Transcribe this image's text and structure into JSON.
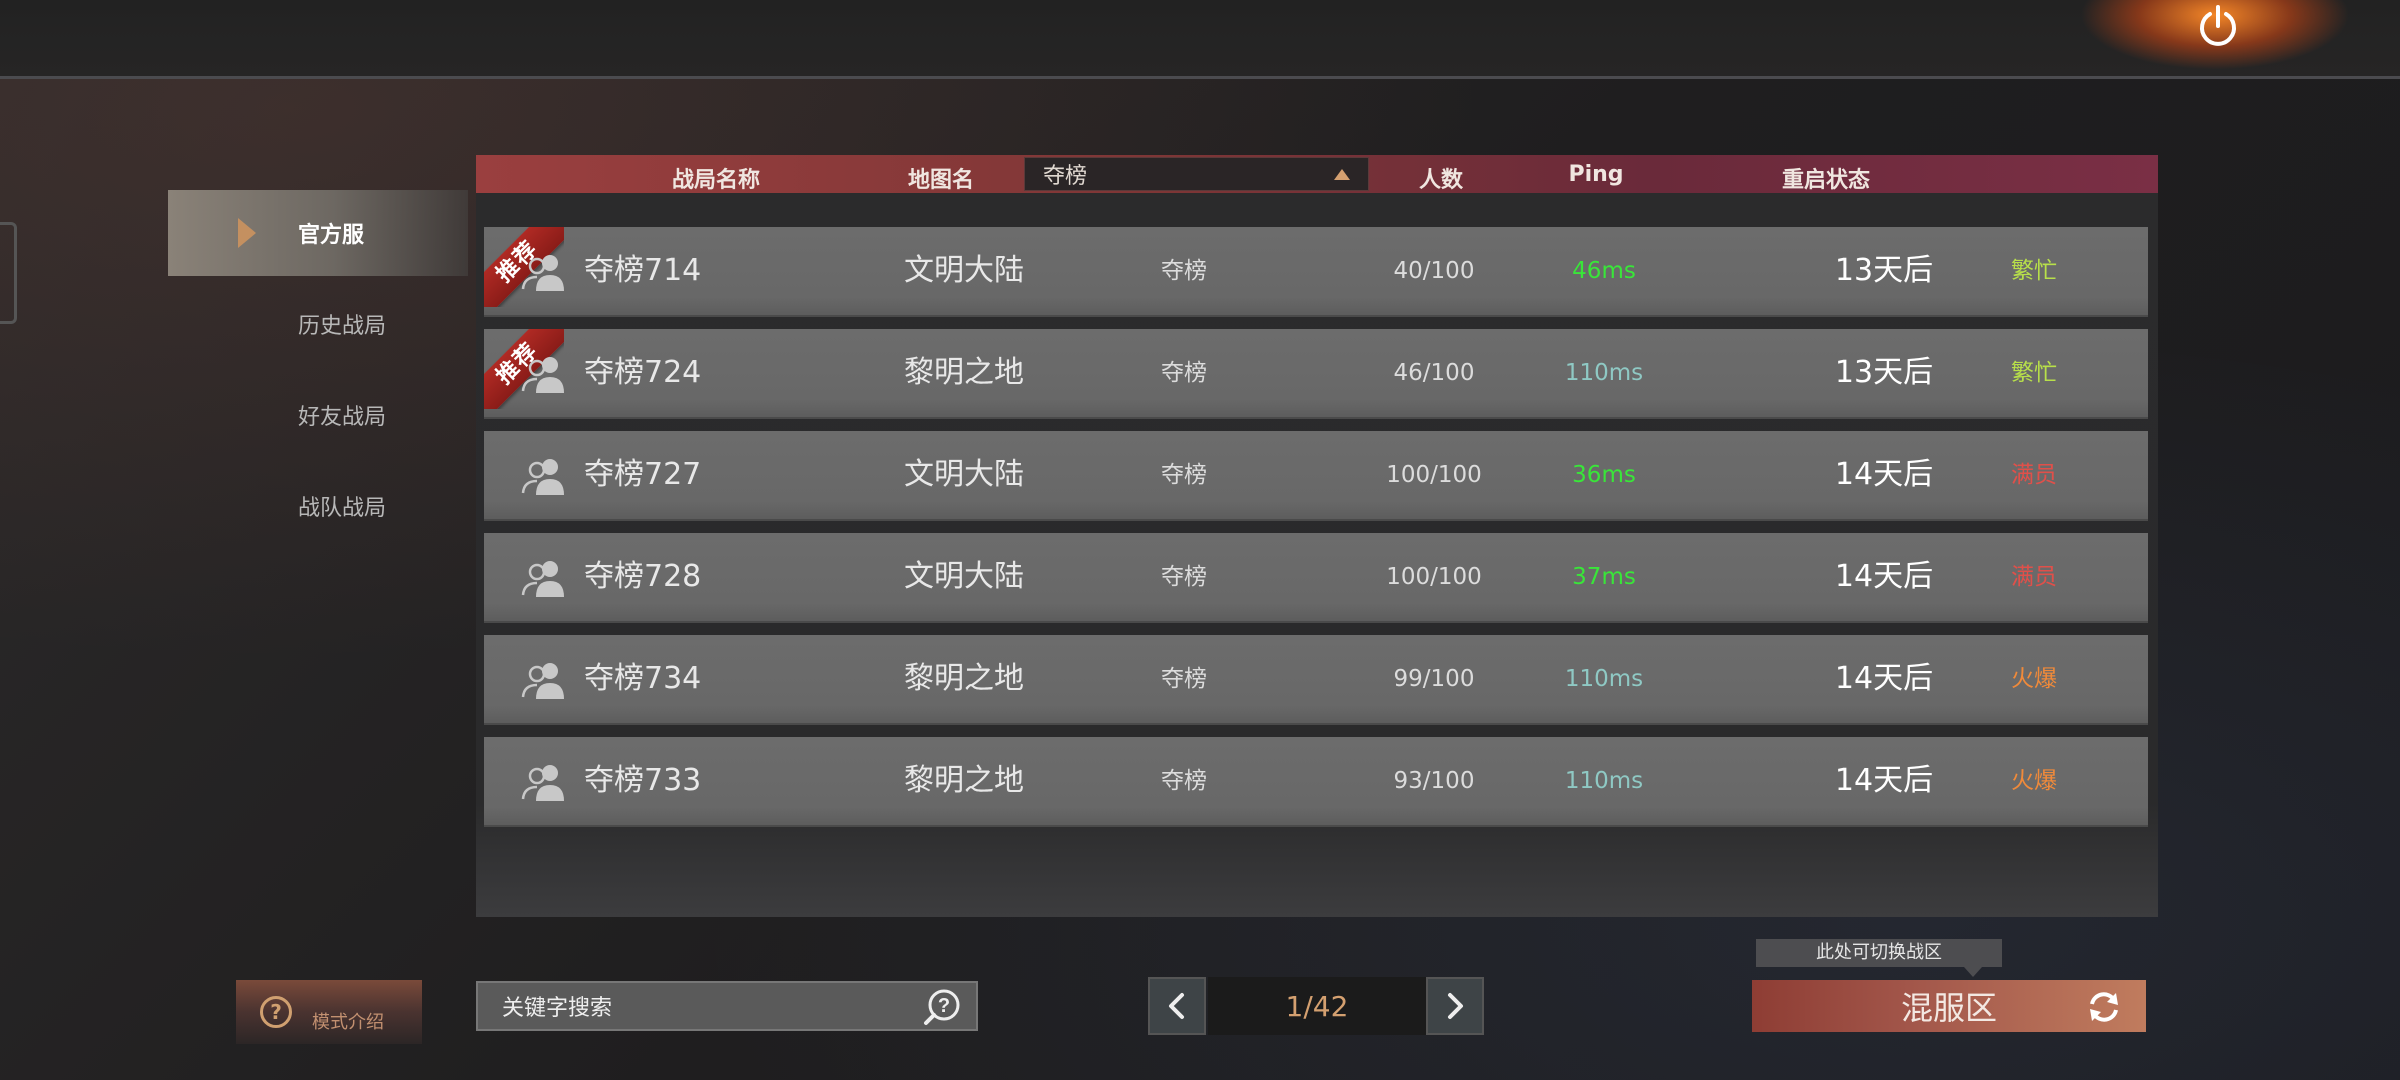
{
  "header": {
    "col_name": "战局名称",
    "col_map": "地图名",
    "map_filter": "夺榜",
    "col_players": "人数",
    "col_ping": "Ping",
    "col_restart": "重启状态"
  },
  "sidebar": {
    "items": [
      {
        "label": "官方服",
        "active": true
      },
      {
        "label": "历史战局",
        "active": false
      },
      {
        "label": "好友战局",
        "active": false
      },
      {
        "label": "战队战局",
        "active": false
      }
    ]
  },
  "rows": [
    {
      "recommended": true,
      "badge": "推荐",
      "name": "夺榜714",
      "map": "文明大陆",
      "mode": "夺榜",
      "players": "40/100",
      "ping": "46ms",
      "ping_color": "#39e639",
      "restart": "13天后",
      "status": "繁忙",
      "status_color": "#b8e04a"
    },
    {
      "recommended": true,
      "badge": "推荐",
      "name": "夺榜724",
      "map": "黎明之地",
      "mode": "夺榜",
      "players": "46/100",
      "ping": "110ms",
      "ping_color": "#8fc9c4",
      "restart": "13天后",
      "status": "繁忙",
      "status_color": "#b8e04a"
    },
    {
      "recommended": false,
      "badge": "",
      "name": "夺榜727",
      "map": "文明大陆",
      "mode": "夺榜",
      "players": "100/100",
      "ping": "36ms",
      "ping_color": "#39e639",
      "restart": "14天后",
      "status": "满员",
      "status_color": "#e0504a"
    },
    {
      "recommended": false,
      "badge": "",
      "name": "夺榜728",
      "map": "文明大陆",
      "mode": "夺榜",
      "players": "100/100",
      "ping": "37ms",
      "ping_color": "#39e639",
      "restart": "14天后",
      "status": "满员",
      "status_color": "#e0504a"
    },
    {
      "recommended": false,
      "badge": "",
      "name": "夺榜734",
      "map": "黎明之地",
      "mode": "夺榜",
      "players": "99/100",
      "ping": "110ms",
      "ping_color": "#8fc9c4",
      "restart": "14天后",
      "status": "火爆",
      "status_color": "#f08a3a"
    },
    {
      "recommended": false,
      "badge": "",
      "name": "夺榜733",
      "map": "黎明之地",
      "mode": "夺榜",
      "players": "93/100",
      "ping": "110ms",
      "ping_color": "#8fc9c4",
      "restart": "14天后",
      "status": "火爆",
      "status_color": "#f08a3a"
    }
  ],
  "footer": {
    "mode_intro": "模式介绍",
    "search_placeholder": "关键字搜索",
    "page": "1/42",
    "zone_tip": "此处可切换战区",
    "zone_label": "混服区"
  },
  "icons": {
    "power": "power-icon",
    "search": "search-help-icon",
    "prev": "chevron-left-icon",
    "next": "chevron-right-icon",
    "refresh": "refresh-icon",
    "players": "players-icon"
  },
  "colors": {
    "header_accent": "#8a3a3a",
    "accent_orange": "#d4a070"
  }
}
